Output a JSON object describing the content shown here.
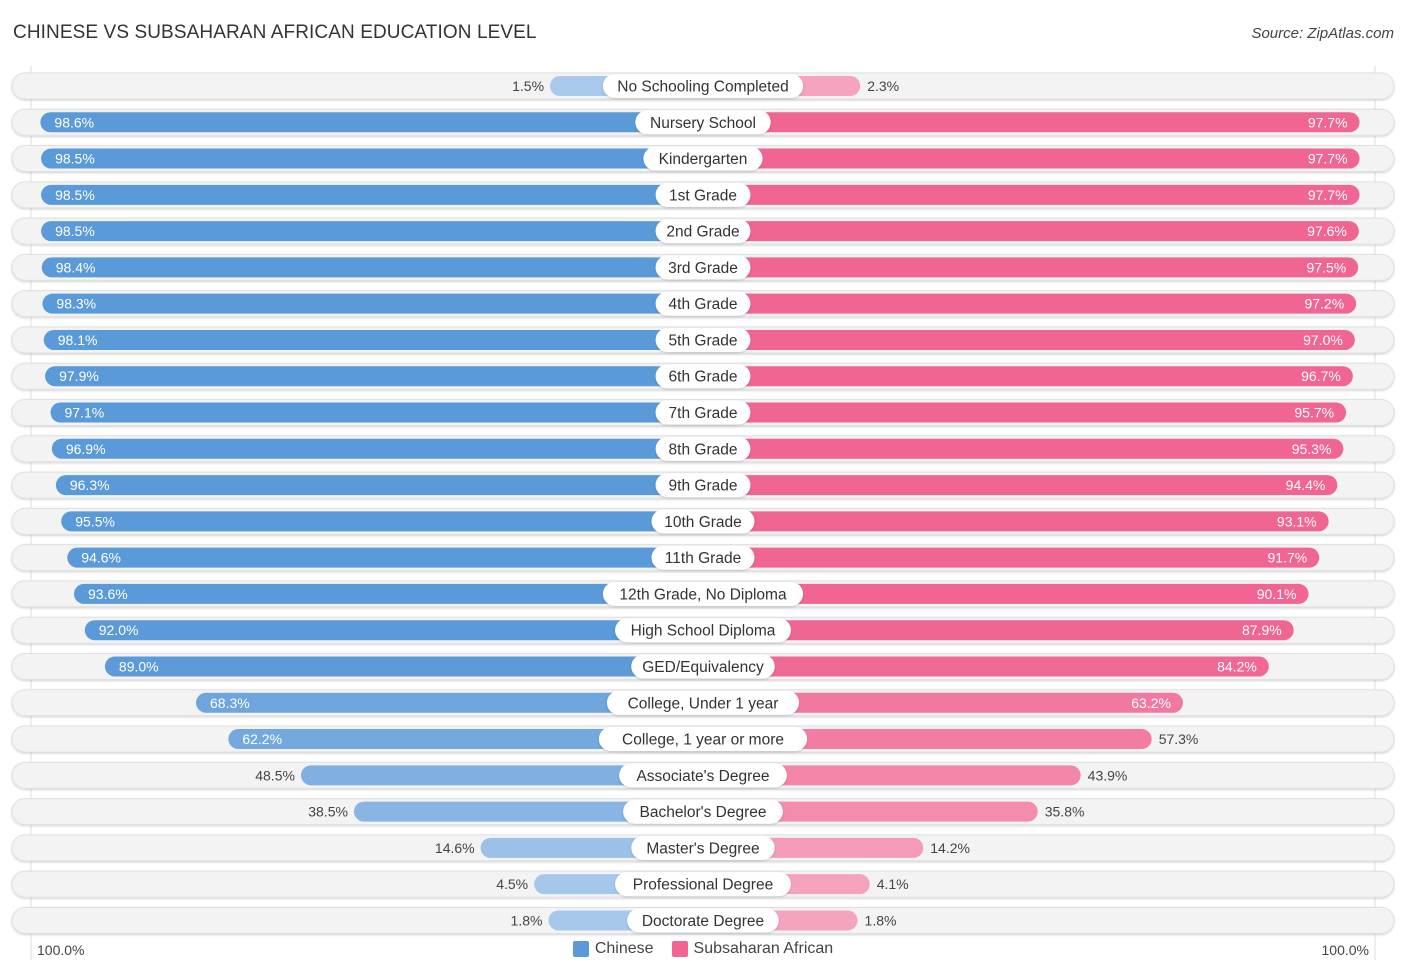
{
  "title": "CHINESE VS SUBSAHARAN AFRICAN EDUCATION LEVEL",
  "source": "Source: ZipAtlas.com",
  "colors": {
    "chinese_strong": "#5b9ad8",
    "chinese_light": "#a9c9ec",
    "subsaharan_strong": "#f06592",
    "subsaharan_light": "#f5a5bf",
    "track": "#f3f3f3"
  },
  "chart_data": {
    "type": "bar",
    "orientation": "horizontal-diverging",
    "title": "CHINESE VS SUBSAHARAN AFRICAN EDUCATION LEVEL",
    "xlim": [
      0,
      100
    ],
    "axis_labels": {
      "left": "100.0%",
      "right": "100.0%"
    },
    "legend": {
      "position": "bottom-center",
      "entries": [
        "Chinese",
        "Subsaharan African"
      ]
    },
    "categories": [
      "No Schooling Completed",
      "Nursery School",
      "Kindergarten",
      "1st Grade",
      "2nd Grade",
      "3rd Grade",
      "4th Grade",
      "5th Grade",
      "6th Grade",
      "7th Grade",
      "8th Grade",
      "9th Grade",
      "10th Grade",
      "11th Grade",
      "12th Grade, No Diploma",
      "High School Diploma",
      "GED/Equivalency",
      "College, Under 1 year",
      "College, 1 year or more",
      "Associate's Degree",
      "Bachelor's Degree",
      "Master's Degree",
      "Professional Degree",
      "Doctorate Degree"
    ],
    "series": [
      {
        "name": "Chinese",
        "values": [
          1.5,
          98.6,
          98.5,
          98.5,
          98.5,
          98.4,
          98.3,
          98.1,
          97.9,
          97.1,
          96.9,
          96.3,
          95.5,
          94.6,
          93.6,
          92.0,
          89.0,
          68.3,
          62.2,
          48.5,
          38.5,
          14.6,
          4.5,
          1.8
        ]
      },
      {
        "name": "Subsaharan African",
        "values": [
          2.3,
          97.7,
          97.7,
          97.7,
          97.6,
          97.5,
          97.2,
          97.0,
          96.7,
          95.7,
          95.3,
          94.4,
          93.1,
          91.7,
          90.1,
          87.9,
          84.2,
          63.2,
          57.3,
          43.9,
          35.8,
          14.2,
          4.1,
          1.8
        ]
      }
    ]
  }
}
